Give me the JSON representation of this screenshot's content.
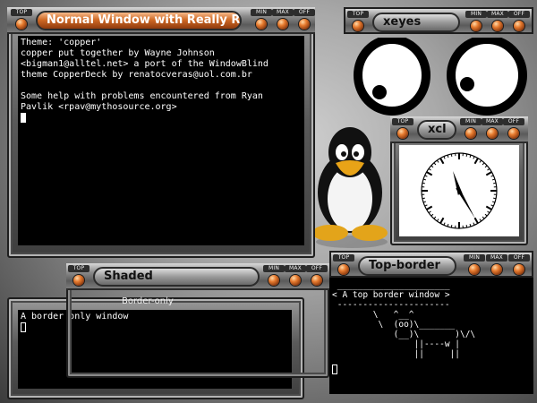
{
  "buttons": {
    "top": "TOP",
    "min": "MIN",
    "max": "MAX",
    "off": "OFF"
  },
  "main_window": {
    "title": "Normal Window with Really Re",
    "lines": [
      "Theme: 'copper'",
      "copper put together by Wayne Johnson",
      "<bigman1@alltel.net> a port of the WindowBlind",
      "theme CopperDeck by renatocveras@uol.com.br",
      "",
      "Some help with problems encountered from Ryan",
      "Pavlik <rpav@mythosource.org>"
    ]
  },
  "xeyes_window": {
    "title": "xeyes"
  },
  "xclock_window": {
    "title": "xcl"
  },
  "shaded_window": {
    "title": "Shaded"
  },
  "border_only_window": {
    "title": "Border-only",
    "line": "A border only window"
  },
  "top_border_window": {
    "title": "Top-border",
    "lines": [
      " ______________________",
      "< A top border window >",
      " ----------------------",
      "        \\   ^__^",
      "         \\  (oo)\\_______",
      "            (__)\\       )\\/\\",
      "                ||----w |",
      "                ||     ||"
    ]
  },
  "clock": {
    "hour": 11,
    "minute": 25
  },
  "colors": {
    "accent": "#d06a26",
    "terminal_bg": "#000000",
    "terminal_fg": "#ffffff"
  }
}
